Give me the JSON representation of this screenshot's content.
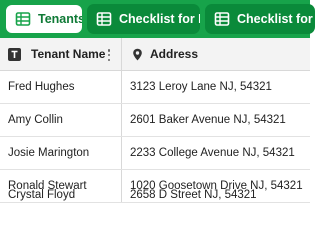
{
  "tabs": [
    {
      "label": "Tenants",
      "icon": "table-icon",
      "active": true
    },
    {
      "label": "Checklist for Re...",
      "icon": "table-icon",
      "active": false
    },
    {
      "label": "Checklist for Pr...",
      "icon": "table-icon",
      "active": false
    }
  ],
  "columns": [
    {
      "label": "Tenant Name",
      "icon": "text-type-icon"
    },
    {
      "label": "Address",
      "icon": "location-pin-icon"
    }
  ],
  "rows": [
    {
      "name": "Fred Hughes",
      "address": "3123 Leroy Lane NJ, 54321"
    },
    {
      "name": "Amy Collin",
      "address": "2601 Baker Avenue NJ, 54321"
    },
    {
      "name": "Josie Marington",
      "address": "2233 College Avenue NJ, 54321"
    },
    {
      "name": "Ronald Stewart",
      "address": "1020 Goosetown Drive NJ, 54321"
    },
    {
      "name": "Crystal Floyd",
      "address": "2658 D Street NJ, 54321"
    }
  ],
  "colors": {
    "accent": "#17a34a",
    "tab_inactive": "#0a8a3a",
    "header_bg": "#f3f3f3"
  }
}
